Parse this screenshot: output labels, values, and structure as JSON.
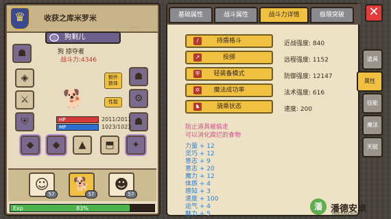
{
  "character": {
    "title": "收获之库米罗米",
    "name": "狗剩儿",
    "class_line": "狗 掠夺者",
    "power": "战斗力:4346",
    "hp_label": "HP",
    "hp_value": "2011/2011",
    "mp_label": "MP",
    "mp_value": "1023/1023",
    "tag_buttons": [
      "额外\n数体",
      "性能"
    ],
    "exp_label": "Exp",
    "exp_percent": "83%",
    "exp_fraction": 0.83
  },
  "team": [
    {
      "level": "57"
    },
    {
      "level": "57"
    },
    {
      "level": "57"
    }
  ],
  "tabs": [
    "基础属性",
    "战斗属性",
    "战斗力详情",
    "极限突破"
  ],
  "active_tab": 2,
  "actions": [
    "持盾格斗",
    "投掷",
    "轻装备模式",
    "魔法成功率",
    "骑乘状态"
  ],
  "stats": [
    {
      "label": "近战强度:",
      "value": "840"
    },
    {
      "label": "远程强度:",
      "value": "1152"
    },
    {
      "label": "防御强度:",
      "value": "12147"
    },
    {
      "label": "法术强度:",
      "value": "616"
    },
    {
      "label": "速度:",
      "value": "200"
    }
  ],
  "notes": [
    "防止道具被偷走",
    "可以消化腐烂的食物"
  ],
  "bonuses": [
    "力量 + 12",
    "灵巧 + 12",
    "意志 + 9",
    "意志 + 20",
    "魔力 + 12",
    "体质 + 4",
    "感知 + 3",
    "速度 + 100",
    "运气 + 4",
    "魅力 + 5"
  ],
  "side_tabs": [
    "道具",
    "属性",
    "技能",
    "魔法",
    "天赋"
  ],
  "active_side_tab": 1,
  "watermark": {
    "text": "潘德安卓",
    "sub": "PANDEANDROID"
  },
  "colors": {
    "accent": "#f0c040",
    "hp": "#d73a3a",
    "mp": "#2f6fd1",
    "exp": "#4cb34c",
    "close": "#e33b3b"
  }
}
